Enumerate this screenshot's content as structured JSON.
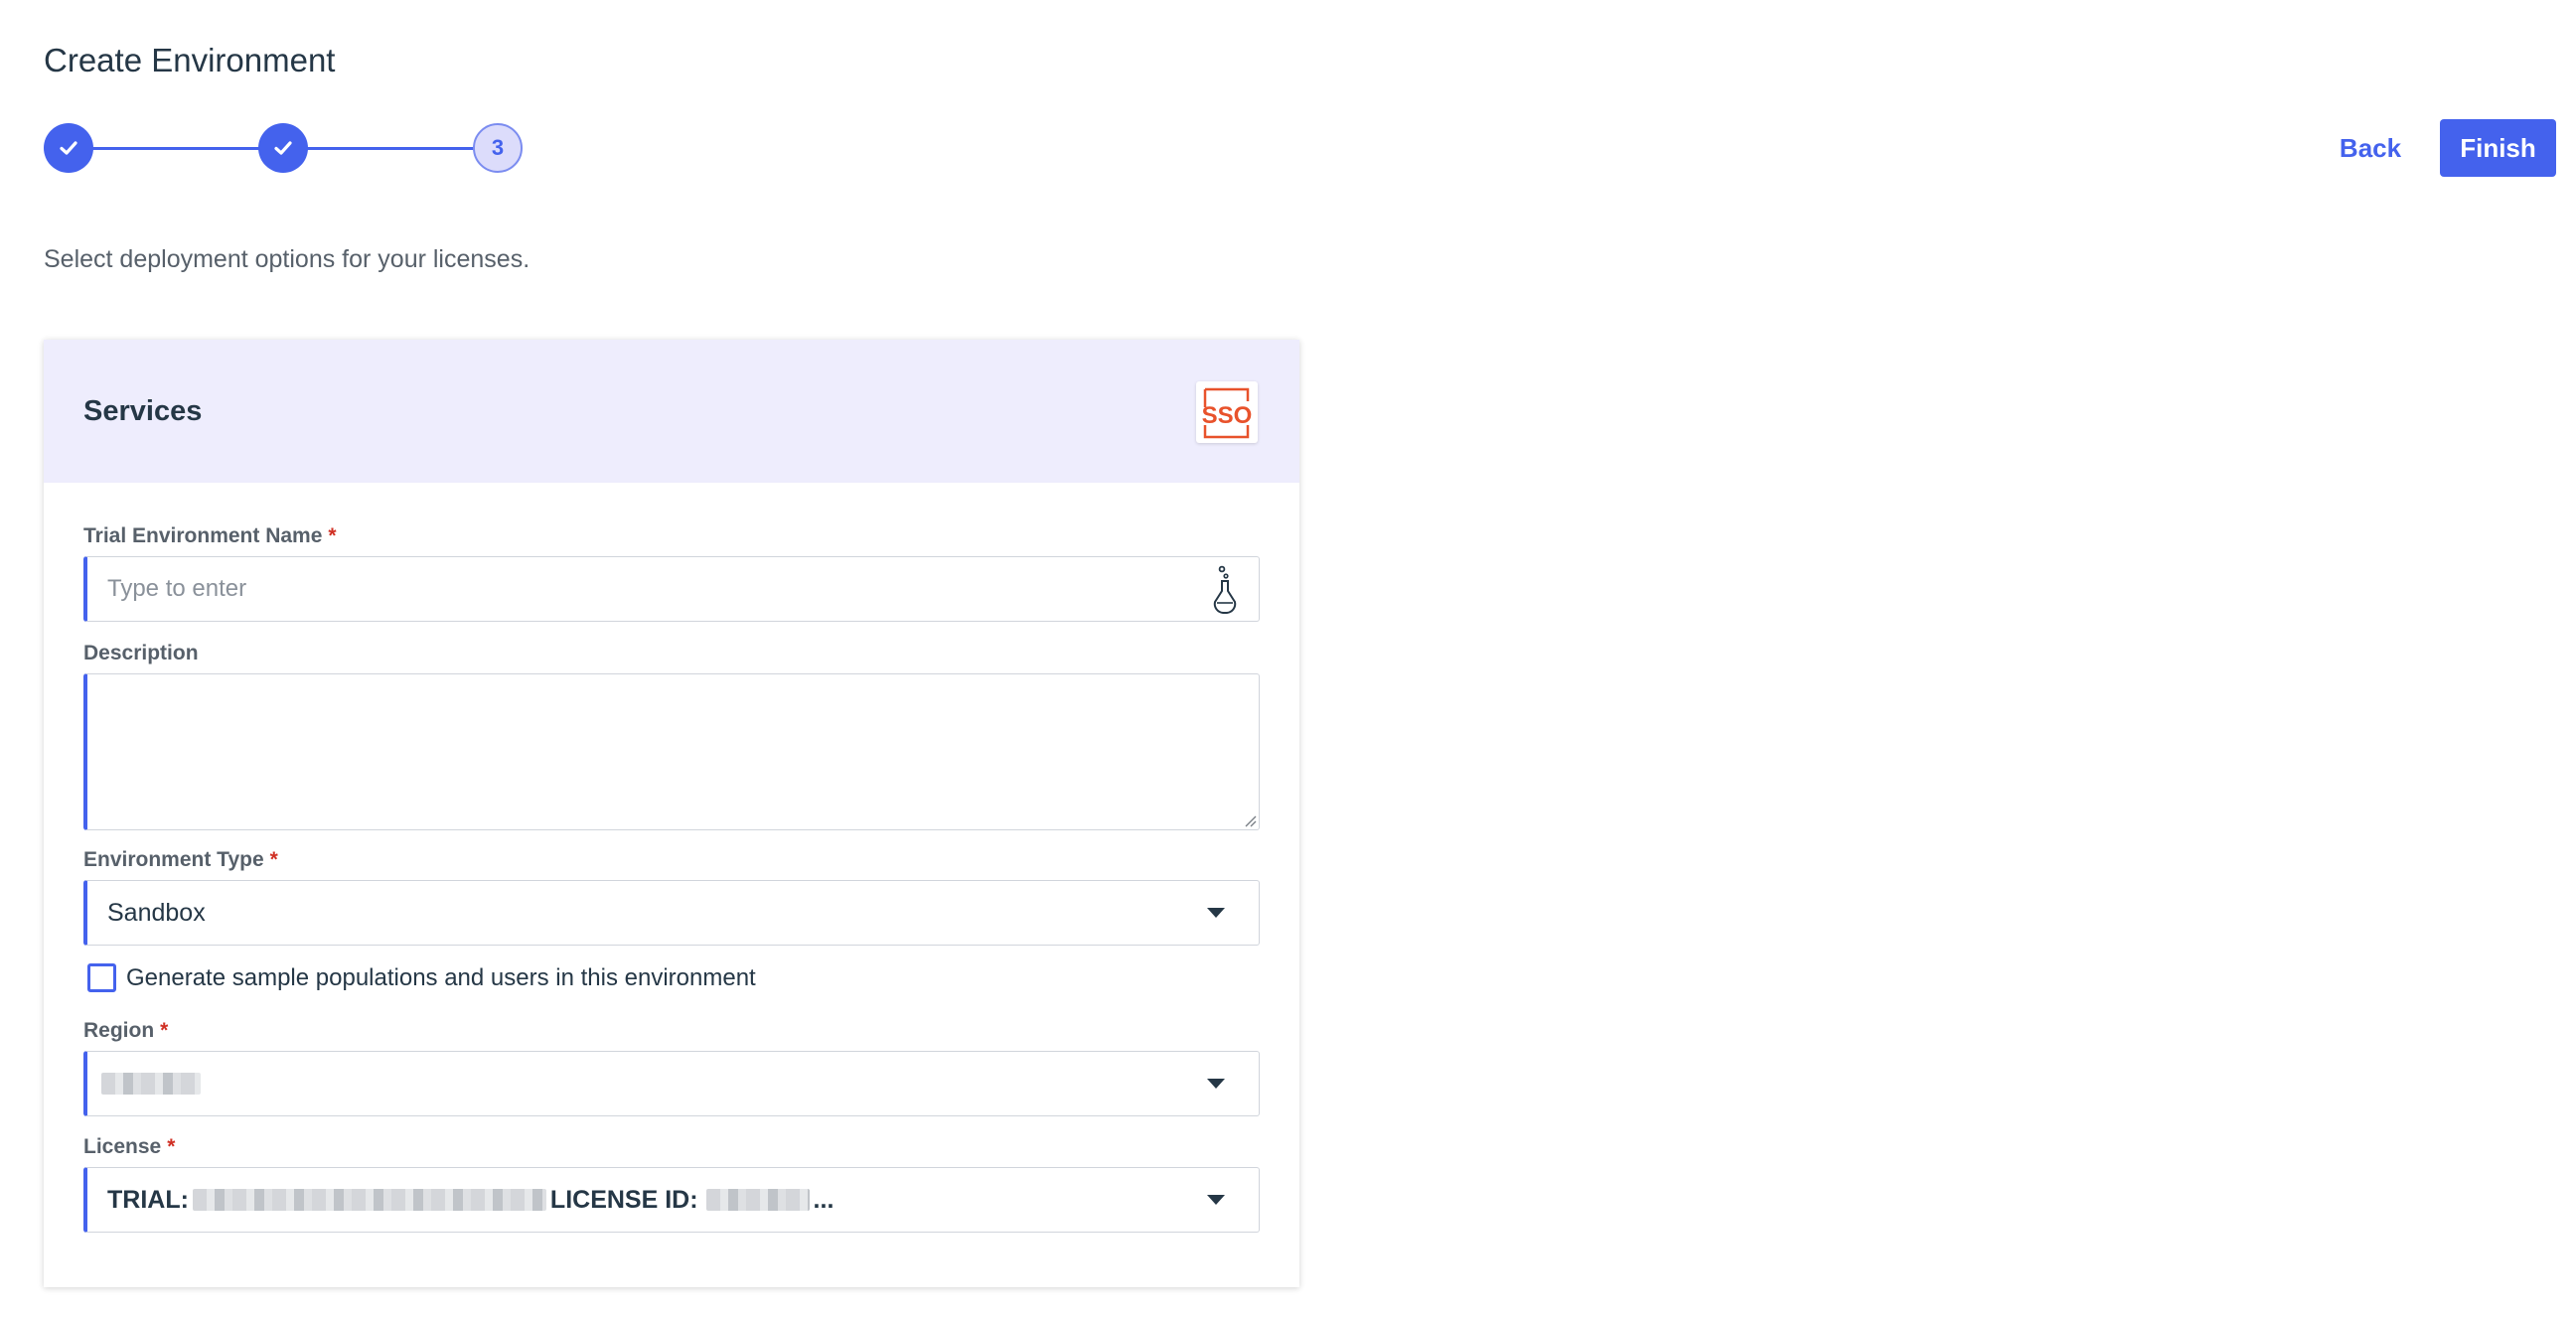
{
  "page": {
    "title": "Create Environment",
    "subtitle": "Select deployment options for your licenses."
  },
  "stepper": {
    "steps": [
      {
        "status": "complete",
        "icon": "check-icon"
      },
      {
        "status": "complete",
        "icon": "check-icon"
      },
      {
        "status": "current",
        "label": "3"
      }
    ]
  },
  "header_actions": {
    "back_label": "Back",
    "finish_label": "Finish"
  },
  "colors": {
    "accent": "#4462ed",
    "header_band": "#eeedfd",
    "required": "#d03024",
    "sso_logo": "#e8522b"
  },
  "card": {
    "title": "Services",
    "logo_text": "SSO",
    "fields": {
      "name": {
        "label": "Trial Environment Name",
        "required_mark": "*",
        "placeholder": "Type to enter",
        "value": ""
      },
      "description": {
        "label": "Description",
        "value": ""
      },
      "environment_type": {
        "label": "Environment Type",
        "required_mark": "*",
        "selected": "Sandbox"
      },
      "sample_data": {
        "label": "Generate sample populations and users in this environment",
        "checked": false
      },
      "region": {
        "label": "Region",
        "required_mark": "*",
        "selected": ""
      },
      "license": {
        "label": "License",
        "required_mark": "*",
        "prefix": "TRIAL:",
        "id_label": "LICENSE ID:",
        "suffix": "..."
      }
    }
  }
}
